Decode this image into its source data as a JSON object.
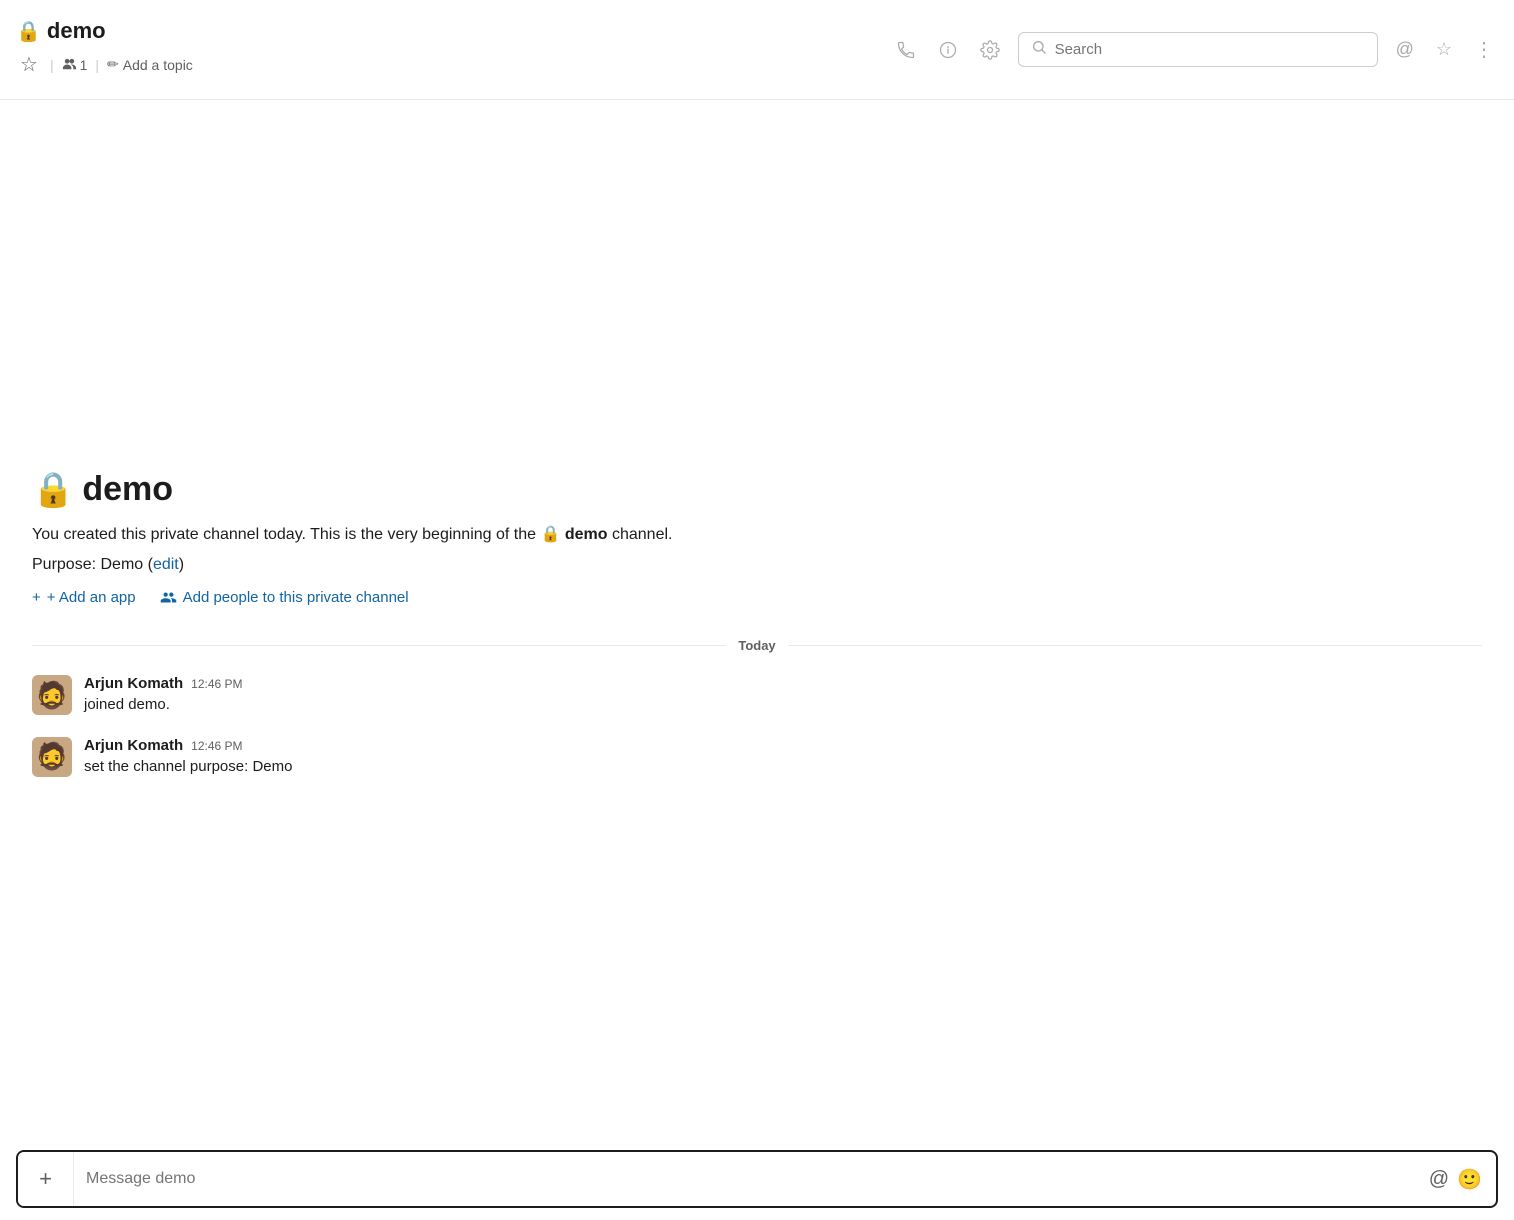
{
  "header": {
    "channel_name": "demo",
    "lock_icon": "🔒",
    "star_icon": "☆",
    "people_count": "1",
    "add_topic_label": "Add a topic",
    "search_placeholder": "Search",
    "call_icon": "📞",
    "info_icon": "ℹ",
    "gear_icon": "⚙",
    "at_icon": "@",
    "favorite_icon": "☆",
    "more_icon": "⋮"
  },
  "channel_intro": {
    "title": "demo",
    "lock_icon": "🔒",
    "description_start": "You created this private channel today. This is the very beginning of the",
    "lock_inline": "🔒",
    "channel_bold": "demo",
    "description_end": "channel.",
    "purpose_label": "Purpose: Demo (",
    "edit_label": "edit",
    "purpose_close": ")",
    "add_app_label": "+ Add an app",
    "add_people_label": "Add people to this private channel"
  },
  "date_divider": {
    "label": "Today"
  },
  "messages": [
    {
      "sender": "Arjun Komath",
      "time": "12:46 PM",
      "text": "joined demo.",
      "avatar_emoji": "🧑"
    },
    {
      "sender": "Arjun Komath",
      "time": "12:46 PM",
      "text": "set the channel purpose: Demo",
      "avatar_emoji": "🧑"
    }
  ],
  "message_input": {
    "placeholder": "Message demo",
    "plus_label": "+",
    "at_label": "@",
    "emoji_label": "🙂"
  }
}
